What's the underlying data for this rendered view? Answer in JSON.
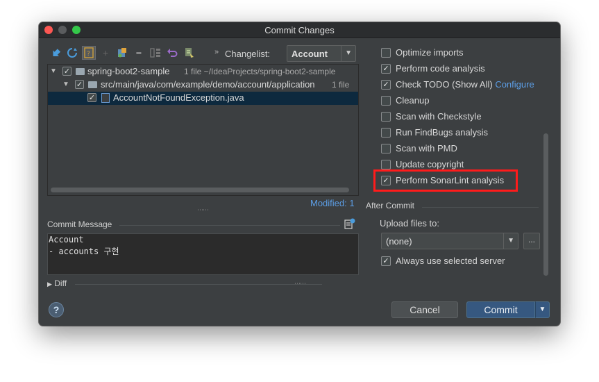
{
  "window": {
    "title": "Commit Changes"
  },
  "toolbar": {
    "changelist_label": "Changelist:",
    "changelist_value": "Account",
    "icons": [
      "move-icon",
      "refresh-icon",
      "group-icon",
      "add-icon",
      "jump-icon",
      "remove-icon",
      "diff-icon",
      "revert-icon",
      "shelve-icon"
    ]
  },
  "tree": {
    "rows": [
      {
        "name": "spring-boot2-sample",
        "meta": "1 file  ~/IdeaProjects/spring-boot2-sample"
      },
      {
        "name": "src/main/java/com/example/demo/account/application",
        "meta": "1 file"
      },
      {
        "name": "AccountNotFoundException.java",
        "meta": ""
      }
    ],
    "modified": "Modified: 1"
  },
  "commit_message": {
    "label": "Commit Message",
    "line1": "Account",
    "line2": "- accounts 구현"
  },
  "diff": {
    "label": "Diff"
  },
  "before_commit": {
    "options": [
      {
        "label": "Optimize imports",
        "checked": false
      },
      {
        "label": "Perform code analysis",
        "checked": true
      },
      {
        "label": "Check TODO (Show All)",
        "checked": true,
        "link": "Configure"
      },
      {
        "label": "Cleanup",
        "checked": false
      },
      {
        "label": "Scan with Checkstyle",
        "checked": false
      },
      {
        "label": "Run FindBugs analysis",
        "checked": false
      },
      {
        "label": "Scan with PMD",
        "checked": false
      },
      {
        "label": "Update copyright",
        "checked": false
      },
      {
        "label": "Perform SonarLint analysis",
        "checked": true
      }
    ]
  },
  "after_commit": {
    "label": "After Commit",
    "upload_label": "Upload files to:",
    "upload_value": "(none)",
    "more_label": "...",
    "always_use": {
      "label": "Always use selected server",
      "checked": true
    }
  },
  "buttons": {
    "help": "?",
    "cancel": "Cancel",
    "commit": "Commit"
  },
  "colors": {
    "window_bg": "#3c3f41",
    "selection": "#0d293e",
    "link": "#5c9ee6",
    "highlight_border": "#ff1b1b",
    "commit_button": "#365880"
  }
}
